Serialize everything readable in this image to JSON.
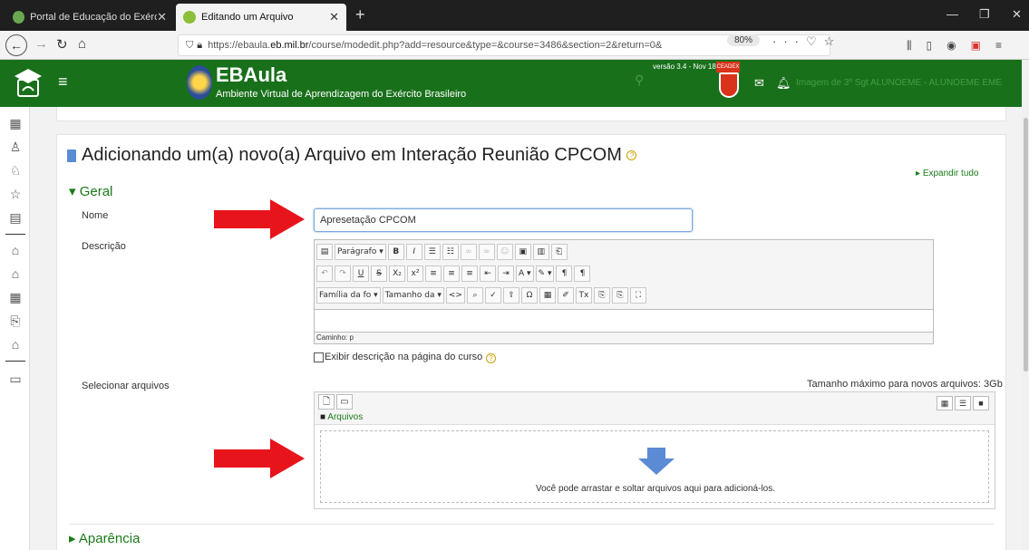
{
  "browser": {
    "tabs": [
      {
        "label": "Portal de Educação do Exército"
      },
      {
        "label": "Editando um Arquivo"
      }
    ],
    "url_prefix": "https://ebaula.",
    "url_domain": "eb.mil.br",
    "url_rest": "/course/modedit.php?add=resource&type=&course=3486&section=2&return=0&",
    "zoom": "80%"
  },
  "header": {
    "title": "EBAula",
    "subtitle": "Ambiente Virtual de Aprendizagem do Exército Brasileiro",
    "version": "versão 3.4 - Nov 18",
    "badge": "CEADEX",
    "user": "Imagem de 3º Sgt ALUNOEME - ALUNOEME EME"
  },
  "page": {
    "title": "Adicionando um(a) novo(a) Arquivo em Interação Reunião CPCOM",
    "expand_all": "Expandir tudo",
    "section_general": "Geral",
    "section_appearance": "Aparência"
  },
  "form": {
    "name_label": "Nome",
    "name_value": "Apresetação CPCOM",
    "description_label": "Descrição",
    "editor_format": "Parágrafo",
    "editor_font": "Família da fo",
    "editor_size": "Tamanho da",
    "editor_path": "Caminho: p",
    "show_description_label": "Exibir descrição na página do curso",
    "select_files_label": "Selecionar arquivos",
    "max_size": "Tamanho máximo para novos arquivos: 3Gb",
    "files_folder": "Arquivos",
    "drop_text": "Você pode arrastar e soltar arquivos aqui para adicioná-los."
  },
  "colors": {
    "header_green": "#19701b",
    "link_green": "#1a7a1a",
    "arrow_red": "#e8141b"
  }
}
